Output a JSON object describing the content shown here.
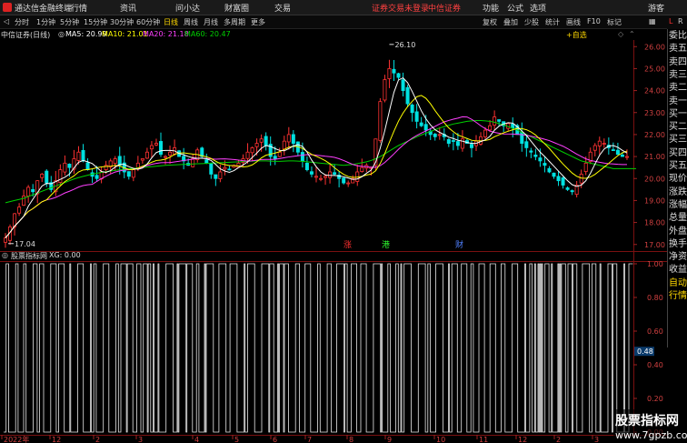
{
  "app": {
    "title": "通达信金融终端",
    "guest": "游客",
    "warning": "证券交易未登录",
    "broker": "中信证券"
  },
  "menu": [
    "行情",
    "资讯",
    "问小达",
    "财富圈",
    "交易"
  ],
  "rightmenu": [
    "功能",
    "公式",
    "选项"
  ],
  "toolbar": {
    "periods": [
      "分时",
      "1分钟",
      "5分钟",
      "15分钟",
      "30分钟",
      "60分钟",
      "日线",
      "周线",
      "月线",
      "多周期",
      "更多"
    ],
    "active": "日线",
    "tools": [
      "复权",
      "叠加",
      "少股",
      "统计",
      "画线",
      "F10",
      "标记"
    ],
    "back_icon": "back-arrow-icon",
    "layout_icon": "layout-grid-icon",
    "auto_select": "+自选"
  },
  "indicators": {
    "title": "中信证券(日线)",
    "ma5": "MA5: 20.99",
    "ma10": "MA10: 21.01",
    "ma20": "MA20: 21.18",
    "ma60": "MA60: 20.47",
    "colors": {
      "ma5": "#ffffff",
      "ma10": "#ffff00",
      "ma20": "#ff40ff",
      "ma60": "#00d000"
    }
  },
  "lower": {
    "name": "股票指标网",
    "xg": "XG: 0.00",
    "value_label": "0.48"
  },
  "price_axis": [
    "26.00",
    "25.00",
    "24.00",
    "23.00",
    "22.00",
    "21.00",
    "20.00",
    "19.00",
    "18.00",
    "17.00"
  ],
  "lower_axis": [
    "1.00",
    "0.80",
    "0.60",
    "0.40",
    "0.20",
    "0.00"
  ],
  "markers": {
    "high": "26.10",
    "low": "17.04"
  },
  "events": [
    {
      "label": "涨",
      "color": "#ff3030"
    },
    {
      "label": "港",
      "color": "#30ff30"
    },
    {
      "label": "财",
      "color": "#5080ff"
    }
  ],
  "date_axis": [
    "2022年",
    "12",
    "2",
    "3",
    "4",
    "5",
    "6",
    "7",
    "8",
    "9",
    "10",
    "11",
    "12",
    "2",
    "3"
  ],
  "right_panel": {
    "top": [
      "L",
      "R"
    ],
    "items": [
      "委比",
      "卖五",
      "卖四",
      "卖三",
      "卖二",
      "卖一",
      "买一",
      "买二",
      "买三",
      "买四",
      "买五",
      "现价",
      "涨跌",
      "涨幅",
      "总量",
      "外盘",
      "换手",
      "净资",
      "收益",
      "自动",
      "行情"
    ]
  },
  "watermark": {
    "line1": "股票指标网",
    "line2": "www.7gpzb.com"
  },
  "chart_data": {
    "type": "candlestick",
    "price_range": [
      16.7,
      26.3
    ],
    "close": [
      17.3,
      17.8,
      18.4,
      18.7,
      19.2,
      19.6,
      19.4,
      19.9,
      20.2,
      19.8,
      19.5,
      19.9,
      20.4,
      20.7,
      20.5,
      20.9,
      21.2,
      20.8,
      20.4,
      20.1,
      20.0,
      20.3,
      20.6,
      20.8,
      20.9,
      20.6,
      20.3,
      20.1,
      20.4,
      20.7,
      20.9,
      21.2,
      21.5,
      21.6,
      21.1,
      21.0,
      21.2,
      21.4,
      21.0,
      20.8,
      20.6,
      20.9,
      21.3,
      21.0,
      20.7,
      20.2,
      20.0,
      20.3,
      20.5,
      20.4,
      20.6,
      20.7,
      20.9,
      21.2,
      21.4,
      21.6,
      21.8,
      21.5,
      21.0,
      20.9,
      21.2,
      21.7,
      22.0,
      21.6,
      21.2,
      20.8,
      20.4,
      20.2,
      20.1,
      20.0,
      20.1,
      20.3,
      20.2,
      20.0,
      19.8,
      19.8,
      20.0,
      20.3,
      20.5,
      20.6,
      20.5,
      21.8,
      23.5,
      24.5,
      25.0,
      24.8,
      24.6,
      24.0,
      23.4,
      23.0,
      22.6,
      22.4,
      22.2,
      22.0,
      21.9,
      22.0,
      21.9,
      21.6,
      21.7,
      21.5,
      21.8,
      21.6,
      21.4,
      21.7,
      21.9,
      22.2,
      22.4,
      22.8,
      22.6,
      22.4,
      22.5,
      22.3,
      22.0,
      21.6,
      21.4,
      21.2,
      21.0,
      20.8,
      20.6,
      20.3,
      20.1,
      19.9,
      19.7,
      19.5,
      19.4,
      19.7,
      20.2,
      20.7,
      21.2,
      21.5,
      21.7,
      21.6,
      21.4,
      21.3,
      21.1,
      21.0,
      21.0
    ],
    "ma60": [
      18.9,
      18.95,
      19.0,
      19.05,
      19.1,
      19.18,
      19.26,
      19.34,
      19.42,
      19.5,
      19.58,
      19.66,
      19.74,
      19.82,
      19.9,
      19.98,
      20.04,
      20.1,
      20.15,
      20.2,
      20.24,
      20.28,
      20.31,
      20.34,
      20.37,
      20.4,
      20.42,
      20.44,
      20.46,
      20.48,
      20.5,
      20.52,
      20.54,
      20.56,
      20.58,
      20.6,
      20.61,
      20.62,
      20.63,
      20.64,
      20.65,
      20.66,
      20.67,
      20.68,
      20.69,
      20.7,
      20.71,
      20.72,
      20.73,
      20.74,
      20.75,
      20.76,
      20.77,
      20.78,
      20.79,
      20.8,
      20.8,
      20.8,
      20.79,
      20.78,
      20.78,
      20.79,
      20.8,
      20.8,
      20.79,
      20.78,
      20.76,
      20.74,
      20.72,
      20.7,
      20.68,
      20.66,
      20.64,
      20.62,
      20.6,
      20.62,
      20.64,
      20.68,
      20.72,
      20.76,
      20.82,
      20.9,
      21.0,
      21.12,
      21.25,
      21.38,
      21.5,
      21.6,
      21.7,
      21.8,
      21.9,
      21.98,
      22.06,
      22.14,
      22.22,
      22.3,
      22.36,
      22.42,
      22.48,
      22.52,
      22.56,
      22.6,
      22.62,
      22.64,
      22.64,
      22.62,
      22.6,
      22.56,
      22.5,
      22.44,
      22.36,
      22.28,
      22.2,
      22.1,
      22.0,
      21.9,
      21.8,
      21.7,
      21.6,
      21.5,
      21.4,
      21.3,
      21.2,
      21.1,
      21.0,
      20.9,
      20.8,
      20.75,
      20.7,
      20.65,
      20.6,
      20.55,
      20.5,
      20.45,
      20.45,
      20.45,
      20.45,
      20.45,
      20.45
    ],
    "binary_signal": "square-wave oscillating between 0.00 and 1.00"
  }
}
